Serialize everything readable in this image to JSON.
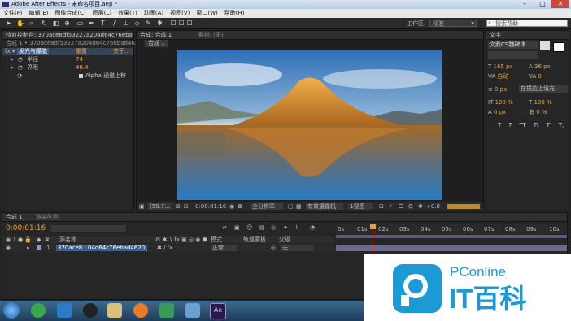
{
  "window": {
    "title": "Adobe After Effects - 未命名项目.aep *"
  },
  "menu": [
    "文件(F)",
    "编辑(E)",
    "图像合成(C)",
    "图层(L)",
    "效果(T)",
    "动画(A)",
    "视图(V)",
    "窗口(W)",
    "帮助(H)"
  ],
  "toolbar": {
    "workspace_label": "工作区:",
    "workspace_value": "标准",
    "search_placeholder": "搜索帮助"
  },
  "effects_panel": {
    "tab_label": "特效控制台: 370ace8df53227a204d64c76eba",
    "layer_path": "合成 1 • 370ace8df53227a204d64c76ebad4620.jpg",
    "effect_name": "发光与朦胧",
    "reset_label": "重置",
    "about_label": "关于...",
    "props": [
      {
        "name": "半径",
        "value": "74"
      },
      {
        "name": "界限",
        "value": "48.4"
      }
    ],
    "alpha_label": "Alpha 通道上移"
  },
  "comp_panel": {
    "tab_label": "合成: 合成 1",
    "footage_label": "素材: (无)",
    "subtab": "合成 1",
    "zoom": "(50.7...",
    "timecode": "0:00:01:16",
    "resolution": "全分辨率",
    "camera": "有效摄像机",
    "view": "1视图",
    "exposure": "+0.0"
  },
  "char_panel": {
    "title": "文字",
    "font": "文鼎CS魏碑体",
    "size": "165 px",
    "leading": "36 px",
    "tracking": "自动",
    "kerning": "0",
    "indent": "0 px",
    "fill_mode": "在描边上填充",
    "v_scale": "100 %",
    "h_scale": "100 %",
    "baseline": "0 px",
    "tsume": "0 %",
    "styles": [
      "T",
      "T",
      "TT",
      "Tt",
      "T'",
      "T,"
    ]
  },
  "timeline": {
    "tab1": "合成 1",
    "tab2": "渲染队列",
    "timecode": "0:00:01:16",
    "col_source": "源名称",
    "col_mode": "模式",
    "col_trkmat": "轨道蒙板",
    "col_parent": "父级",
    "layer_index": "1",
    "layer_name": "370ace8...04d64c76ebad4620.jpg",
    "layer_mode": "正常",
    "layer_parent": "无",
    "ruler": [
      "0s",
      "01s",
      "02s",
      "03s",
      "04s",
      "05s",
      "06s",
      "07s",
      "08s",
      "09s",
      "10s"
    ]
  },
  "watermark": {
    "brand": "PConline",
    "subtitle": "IT百科"
  },
  "colors": {
    "accent_orange": "#e6a33a",
    "cti_red": "#e03a2a",
    "logo_blue": "#1c9ad6"
  },
  "taskbar": {
    "active_app": "Ae"
  }
}
